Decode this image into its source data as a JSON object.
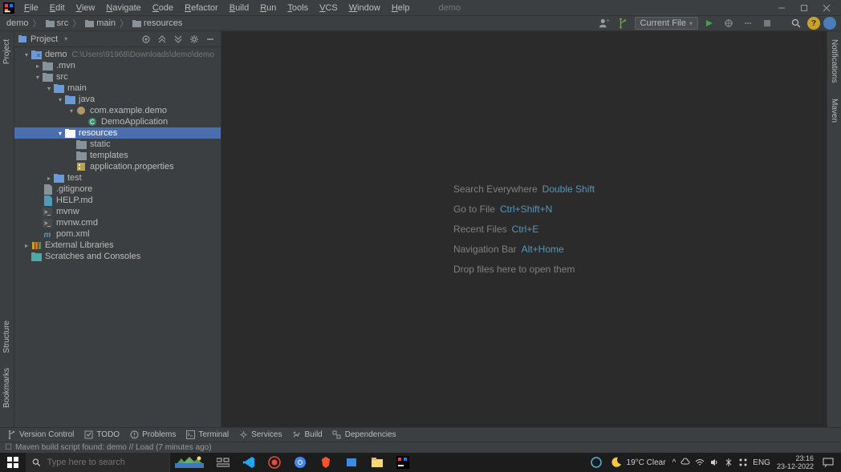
{
  "menu": [
    "File",
    "Edit",
    "View",
    "Navigate",
    "Code",
    "Refactor",
    "Build",
    "Run",
    "Tools",
    "VCS",
    "Window",
    "Help"
  ],
  "title_project": "demo",
  "breadcrumbs": [
    "demo",
    "src",
    "main",
    "resources"
  ],
  "run_config": "Current File",
  "project_panel": {
    "title": "Project"
  },
  "tree": [
    {
      "depth": 0,
      "arrow": "down",
      "icon": "module",
      "label": "demo",
      "hint": "C:\\Users\\91968\\Downloads\\demo\\demo"
    },
    {
      "depth": 1,
      "arrow": "right",
      "icon": "folder",
      "label": ".mvn"
    },
    {
      "depth": 1,
      "arrow": "down",
      "icon": "folder",
      "label": "src"
    },
    {
      "depth": 2,
      "arrow": "down",
      "icon": "folder-blue",
      "label": "main"
    },
    {
      "depth": 3,
      "arrow": "down",
      "icon": "folder-blue",
      "label": "java"
    },
    {
      "depth": 4,
      "arrow": "down",
      "icon": "package",
      "label": "com.example.demo"
    },
    {
      "depth": 5,
      "arrow": "",
      "icon": "class",
      "label": "DemoApplication"
    },
    {
      "depth": 3,
      "arrow": "down",
      "icon": "folder-res",
      "label": "resources",
      "selected": true
    },
    {
      "depth": 4,
      "arrow": "",
      "icon": "folder",
      "label": "static"
    },
    {
      "depth": 4,
      "arrow": "",
      "icon": "folder",
      "label": "templates"
    },
    {
      "depth": 4,
      "arrow": "",
      "icon": "prop",
      "label": "application.properties"
    },
    {
      "depth": 2,
      "arrow": "right",
      "icon": "folder-blue",
      "label": "test"
    },
    {
      "depth": 1,
      "arrow": "",
      "icon": "file",
      "label": ".gitignore"
    },
    {
      "depth": 1,
      "arrow": "",
      "icon": "md",
      "label": "HELP.md"
    },
    {
      "depth": 1,
      "arrow": "",
      "icon": "term",
      "label": "mvnw"
    },
    {
      "depth": 1,
      "arrow": "",
      "icon": "term",
      "label": "mvnw.cmd"
    },
    {
      "depth": 1,
      "arrow": "",
      "icon": "xml",
      "label": "pom.xml"
    },
    {
      "depth": 0,
      "arrow": "right",
      "icon": "lib",
      "label": "External Libraries"
    },
    {
      "depth": 0,
      "arrow": "",
      "icon": "scratch",
      "label": "Scratches and Consoles"
    }
  ],
  "tips": [
    {
      "label": "Search Everywhere",
      "key": "Double Shift"
    },
    {
      "label": "Go to File",
      "key": "Ctrl+Shift+N"
    },
    {
      "label": "Recent Files",
      "key": "Ctrl+E"
    },
    {
      "label": "Navigation Bar",
      "key": "Alt+Home"
    },
    {
      "label": "Drop files here to open them",
      "key": ""
    }
  ],
  "bottom_tools": [
    "Version Control",
    "TODO",
    "Problems",
    "Terminal",
    "Services",
    "Build",
    "Dependencies"
  ],
  "left_gutter": [
    "Project",
    "Structure",
    "Bookmarks"
  ],
  "right_gutter": [
    "Notifications",
    "Maven"
  ],
  "status": "Maven build script found: demo // Load (7 minutes ago)",
  "taskbar": {
    "search_placeholder": "Type here to search",
    "weather": "19°C  Clear",
    "lang": "ENG",
    "time": "23:16",
    "date": "23-12-2022"
  }
}
